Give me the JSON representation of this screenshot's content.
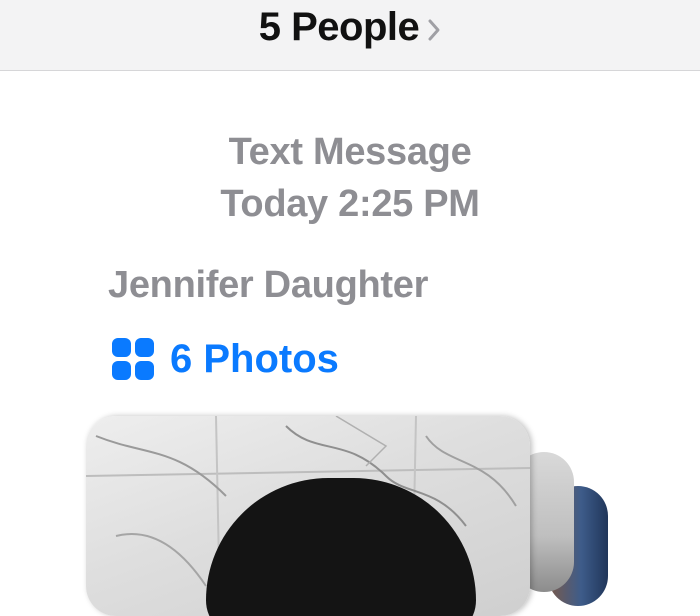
{
  "header": {
    "title": "5 People",
    "chevron_icon": "chevron-right-icon"
  },
  "message": {
    "type_label": "Text Message",
    "timestamp": "Today 2:25 PM",
    "sender": "Jennifer Daughter",
    "attachment": {
      "icon": "photo-grid-icon",
      "label": "6 Photos"
    }
  },
  "colors": {
    "accent": "#0a7aff",
    "secondary_text": "#8e8e93",
    "header_bg": "#f3f3f4"
  }
}
